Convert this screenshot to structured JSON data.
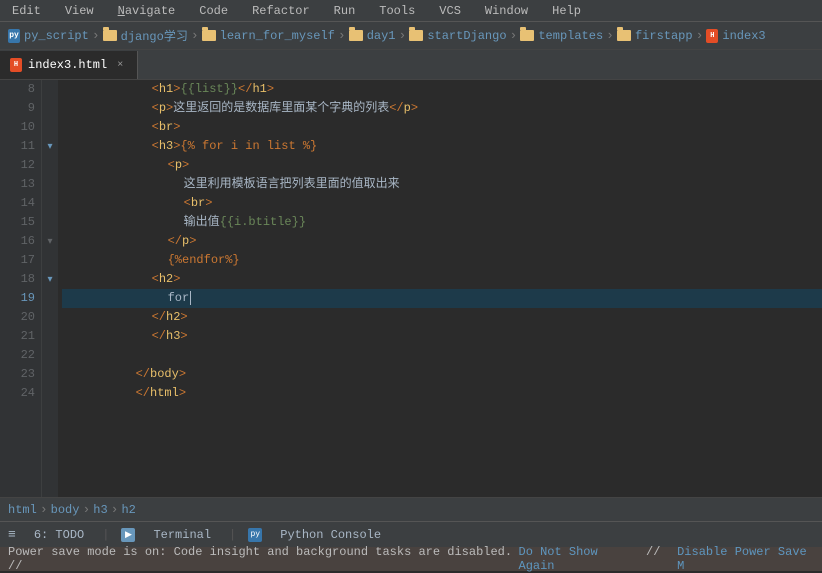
{
  "menubar": {
    "items": [
      "Edit",
      "View",
      "Navigate",
      "Code",
      "Refactor",
      "Run",
      "Tools",
      "VCS",
      "Window",
      "Help"
    ]
  },
  "breadcrumb": {
    "items": [
      {
        "label": "py_script",
        "type": "py"
      },
      {
        "label": "django学习",
        "type": "folder"
      },
      {
        "label": "learn_for_myself",
        "type": "folder"
      },
      {
        "label": "day1",
        "type": "folder"
      },
      {
        "label": "startDjango",
        "type": "folder"
      },
      {
        "label": "templates",
        "type": "folder"
      },
      {
        "label": "firstapp",
        "type": "folder"
      },
      {
        "label": "index3",
        "type": "html"
      }
    ]
  },
  "tab": {
    "label": "index3.html",
    "close_symbol": "×"
  },
  "lines": [
    {
      "num": 8,
      "indent": 2,
      "content": "<h1>{{list}}</h1>",
      "fold": false
    },
    {
      "num": 9,
      "indent": 2,
      "content": "<p>这里返回的是数据库里面某个字典的列表</p>",
      "fold": false
    },
    {
      "num": 10,
      "indent": 2,
      "content": "<br>",
      "fold": false
    },
    {
      "num": 11,
      "indent": 2,
      "content": "<h3>{% for i in list %}",
      "fold": true
    },
    {
      "num": 12,
      "indent": 3,
      "content": "<p>",
      "fold": false
    },
    {
      "num": 13,
      "indent": 4,
      "content": "这里利用模板语言把列表里面的值取出来",
      "fold": false
    },
    {
      "num": 14,
      "indent": 4,
      "content": "<br>",
      "fold": false
    },
    {
      "num": 15,
      "indent": 4,
      "content": "输出值{{i.btitle}}",
      "fold": false
    },
    {
      "num": 16,
      "indent": 3,
      "content": "</p>",
      "fold": false
    },
    {
      "num": 17,
      "indent": 3,
      "content": "{%endfor%}",
      "fold": false
    },
    {
      "num": 18,
      "indent": 2,
      "content": "<h2>",
      "fold": true
    },
    {
      "num": 19,
      "indent": 3,
      "content": "for",
      "fold": false,
      "cursor": true
    },
    {
      "num": 20,
      "indent": 2,
      "content": "</h2>",
      "fold": false
    },
    {
      "num": 21,
      "indent": 2,
      "content": "</h3>",
      "fold": false
    },
    {
      "num": 22,
      "indent": 0,
      "content": "",
      "fold": false
    },
    {
      "num": 23,
      "indent": 1,
      "content": "</body>",
      "fold": false
    },
    {
      "num": 24,
      "indent": 1,
      "content": "</html>",
      "fold": false
    }
  ],
  "bottom_breadcrumb": {
    "items": [
      "html",
      "body",
      "h3",
      "h2"
    ]
  },
  "status_bar": {
    "todo_label": "6: TODO",
    "terminal_label": "Terminal",
    "python_console_label": "Python Console"
  },
  "power_save_banner": {
    "message": "Power save mode is on: Code insight and background tasks are disabled. // Do Not Show Again // Disable Power Save M",
    "do_not_show": "Do Not Show Again",
    "disable": "Disable Power Save M"
  }
}
